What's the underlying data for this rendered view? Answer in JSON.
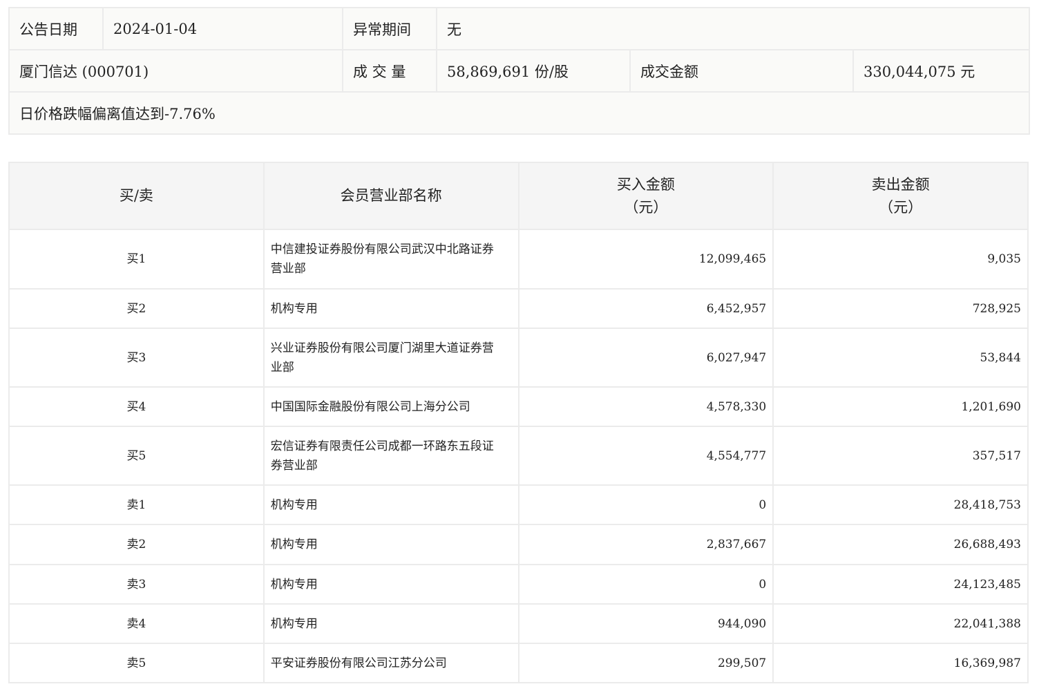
{
  "info": {
    "date_label": "公告日期",
    "date_value": "2024-01-04",
    "period_label": "异常期间",
    "period_value": "无",
    "stock": "厦门信达 (000701)",
    "volume_label": "成 交 量",
    "volume_value": "58,869,691 份/股",
    "amount_label": "成交金额",
    "amount_value": "330,044,075 元",
    "reason": "日价格跌幅偏离值达到-7.76%"
  },
  "table": {
    "headers": [
      "买/卖",
      "会员营业部名称",
      "买入金额\n（元）",
      "卖出金额\n（元）"
    ],
    "rows": [
      {
        "side": "买1",
        "name": "中信建投证券股份有限公司武汉中北路证券营业部",
        "buy": "12,099,465",
        "sell": "9,035"
      },
      {
        "side": "买2",
        "name": "机构专用",
        "buy": "6,452,957",
        "sell": "728,925"
      },
      {
        "side": "买3",
        "name": "兴业证券股份有限公司厦门湖里大道证券营业部",
        "buy": "6,027,947",
        "sell": "53,844"
      },
      {
        "side": "买4",
        "name": "中国国际金融股份有限公司上海分公司",
        "buy": "4,578,330",
        "sell": "1,201,690"
      },
      {
        "side": "买5",
        "name": "宏信证券有限责任公司成都一环路东五段证券营业部",
        "buy": "4,554,777",
        "sell": "357,517"
      },
      {
        "side": "卖1",
        "name": "机构专用",
        "buy": "0",
        "sell": "28,418,753"
      },
      {
        "side": "卖2",
        "name": "机构专用",
        "buy": "2,837,667",
        "sell": "26,688,493"
      },
      {
        "side": "卖3",
        "name": "机构专用",
        "buy": "0",
        "sell": "24,123,485"
      },
      {
        "side": "卖4",
        "name": "机构专用",
        "buy": "944,090",
        "sell": "22,041,388"
      },
      {
        "side": "卖5",
        "name": "平安证券股份有限公司江苏分公司",
        "buy": "299,507",
        "sell": "16,369,987"
      }
    ]
  }
}
